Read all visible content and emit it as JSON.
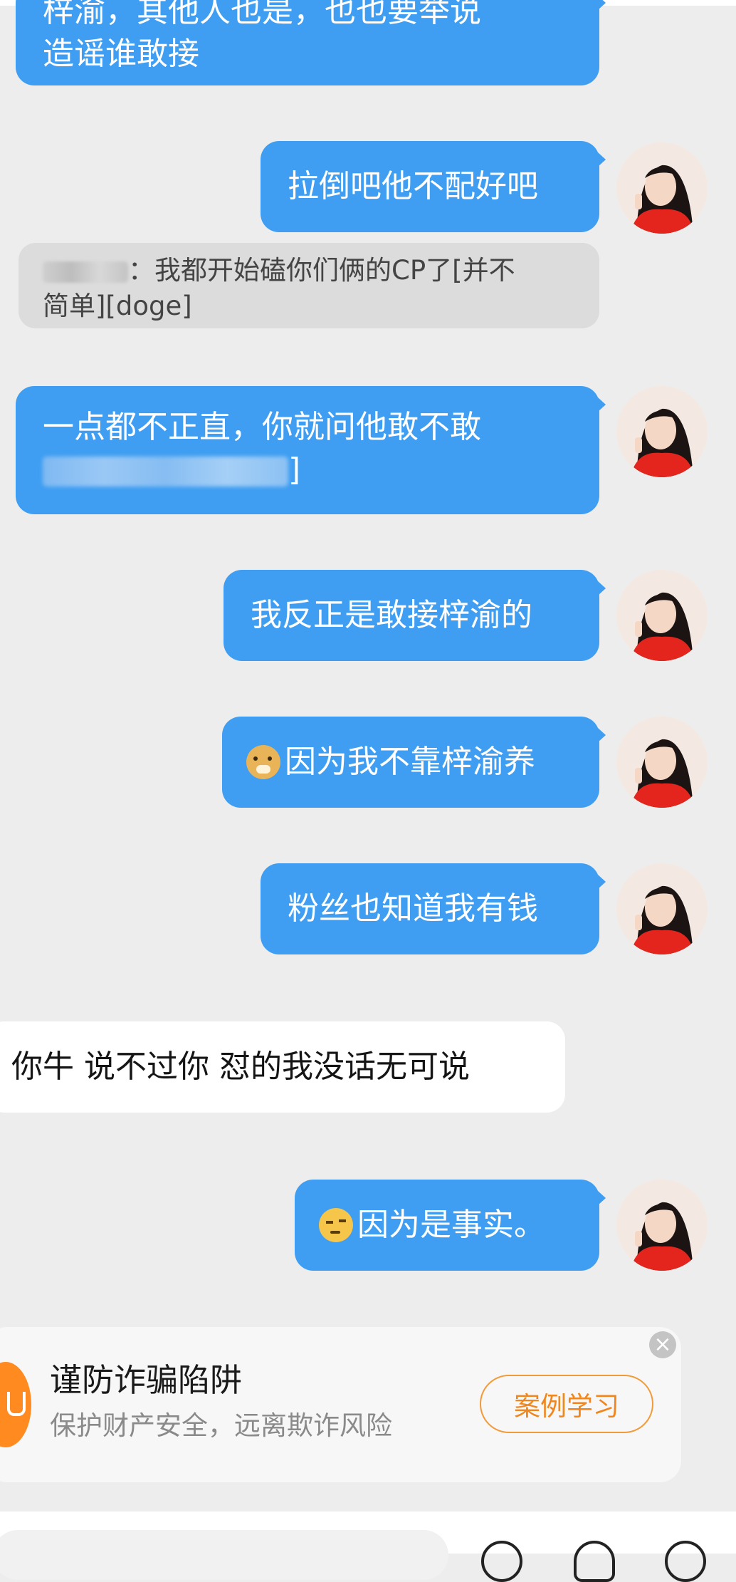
{
  "messages": [
    {
      "text_line1": "梓渝，其他人也是，也也要举说",
      "text_line2": "造谣谁敢接",
      "side": "right"
    },
    {
      "text": "拉倒吧他不配好吧",
      "side": "right"
    },
    {
      "quote_suffix": "：我都开始磕你们俩的CP了[并不",
      "quote_line2": "简单][doge]"
    },
    {
      "text_line1": "一点都不正直，你就问他敢不敢",
      "text_line2_tail": "]",
      "side": "right"
    },
    {
      "text": "我反正是敢接梓渝的",
      "side": "right"
    },
    {
      "emoji": "doge-icon",
      "text": "因为我不靠梓渝养",
      "side": "right"
    },
    {
      "text": "粉丝也知道我有钱",
      "side": "right"
    },
    {
      "text": "你牛 说不过你 怼的我没话无可说",
      "side": "left"
    },
    {
      "emoji": "thinking-icon",
      "text": "因为是事实。",
      "side": "right"
    }
  ],
  "fraud_banner": {
    "title": "谨防诈骗陷阱",
    "subtitle": "保护财产安全，远离欺诈风险",
    "button": "案例学习",
    "close_icon": "close-icon",
    "close_glyph": "×"
  },
  "colors": {
    "outgoing_bubble": "#3f9ef2",
    "incoming_bubble": "#ffffff",
    "background": "#ededed",
    "accent_orange": "#f0871e"
  }
}
